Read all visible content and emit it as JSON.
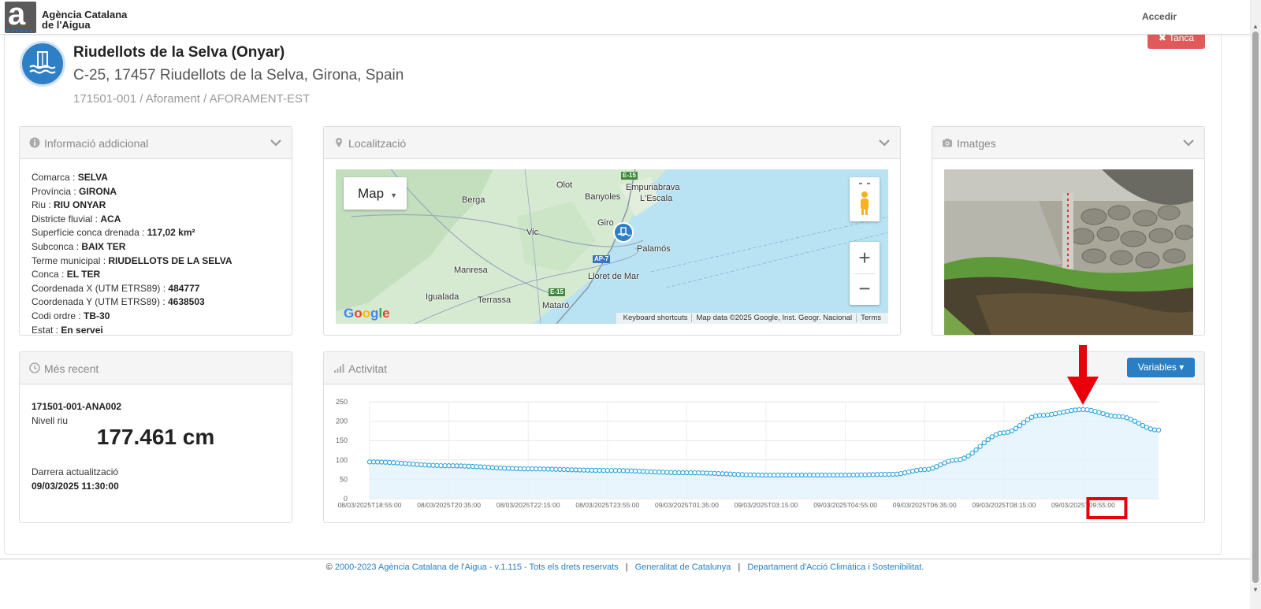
{
  "header": {
    "logo_text_line1": "Agència Catalana",
    "logo_text_line2": "de l'Aigua",
    "login_label": "Accedir",
    "logo_icon": "aca-logo-icon"
  },
  "station": {
    "close_label": "✖ Tanca",
    "title": "Riudellots de la Selva (Onyar)",
    "address": "C-25, 17457 Riudellots de la Selva, Girona, Spain",
    "code": "171501-001 / Aforament / AFORAMENT-EST",
    "icon": "gauging-station-icon"
  },
  "info_panel": {
    "title": "Informació addicional",
    "items": [
      {
        "label": "Comarca",
        "value": "SELVA"
      },
      {
        "label": "Província",
        "value": "GIRONA"
      },
      {
        "label": "Riu",
        "value": "RIU ONYAR"
      },
      {
        "label": "Districte fluvial",
        "value": "ACA"
      },
      {
        "label": "Superfície conca drenada",
        "value": "117,02 km²"
      },
      {
        "label": "Subconca",
        "value": "BAIX TER"
      },
      {
        "label": "Terme municipal",
        "value": "RIUDELLOTS DE LA SELVA"
      },
      {
        "label": "Conca",
        "value": "EL TER"
      },
      {
        "label": "Coordenada X (UTM ETRS89)",
        "value": "484777"
      },
      {
        "label": "Coordenada Y (UTM ETRS89)",
        "value": "4638503"
      },
      {
        "label": "Codi ordre",
        "value": "TB-30"
      },
      {
        "label": "Estat",
        "value": "En servei"
      }
    ]
  },
  "map_panel": {
    "title": "Localització",
    "map_type_label": "Map",
    "zoom_in": "+",
    "zoom_out": "−",
    "attribution": [
      "Keyboard shortcuts",
      "Map data ©2025 Google, Inst. Geogr. Nacional",
      "Terms"
    ],
    "google_label": "Google",
    "places": [
      "Olot",
      "Empuriabrava",
      "Berga",
      "Banyoles",
      "L'Escala",
      "Vic",
      "Giro",
      "Palamós",
      "Manresa",
      "Lloret de Mar",
      "Igualada",
      "Terrassa",
      "Mataró"
    ],
    "road_labels": [
      "E-15",
      "AP-7",
      "E-15"
    ]
  },
  "images_panel": {
    "title": "Imatges"
  },
  "recent_panel": {
    "title": "Més recent",
    "sensor_code": "171501-001-ANA002",
    "variable": "Nivell riu",
    "value": "177.461 cm",
    "updated_label": "Darrera actualització",
    "updated_value": "09/03/2025 11:30:00"
  },
  "activity_panel": {
    "title": "Activitat",
    "variables_label": "Variables ▾"
  },
  "chart_data": {
    "type": "line",
    "title": "",
    "xlabel": "",
    "ylabel": "",
    "ylim": [
      0,
      250
    ],
    "yticks": [
      0,
      50,
      100,
      150,
      200,
      250
    ],
    "xtick_labels": [
      "08/03/2025T18:55:00",
      "08/03/2025T20:35:00",
      "08/03/2025T22:15:00",
      "08/03/2025T23:55:00",
      "09/03/2025T01:35:00",
      "09/03/2025T03:15:00",
      "09/03/2025T04:55:00",
      "09/03/2025T06:35:00",
      "09/03/2025T08:15:00",
      "09/03/2025T09:55:00"
    ],
    "x_start": "08/03/2025T18:55:00",
    "x_end": "09/03/2025T11:30:00",
    "series": [
      {
        "color": "#2aa3de",
        "anchors": [
          {
            "t": "08/03/2025T18:55:00",
            "v": 95
          },
          {
            "t": "08/03/2025T20:35:00",
            "v": 85
          },
          {
            "t": "08/03/2025T22:15:00",
            "v": 77
          },
          {
            "t": "08/03/2025T23:55:00",
            "v": 73
          },
          {
            "t": "09/03/2025T01:35:00",
            "v": 67
          },
          {
            "t": "09/03/2025T03:15:00",
            "v": 61
          },
          {
            "t": "09/03/2025T04:55:00",
            "v": 61
          },
          {
            "t": "09/03/2025T05:55:00",
            "v": 63
          },
          {
            "t": "09/03/2025T06:35:00",
            "v": 75
          },
          {
            "t": "09/03/2025T07:15:00",
            "v": 100
          },
          {
            "t": "09/03/2025T08:15:00",
            "v": 170
          },
          {
            "t": "09/03/2025T09:00:00",
            "v": 215
          },
          {
            "t": "09/03/2025T09:55:00",
            "v": 230
          },
          {
            "t": "09/03/2025T10:40:00",
            "v": 212
          },
          {
            "t": "09/03/2025T11:30:00",
            "v": 177
          }
        ]
      }
    ],
    "grid": true,
    "legend": "none"
  },
  "annotations": {
    "arrow_color": "#e8000b",
    "highlight_color": "#e8000b"
  },
  "footer": {
    "copyright_symbol": "©",
    "copyright": "2000-2023 Agència Catalana de l'Aigua - v.1.115 - Tots els drets reservats",
    "link1": "Generalitat de Catalunya",
    "link2": "Departament d'Acció Climàtica i Sostenibilitat.",
    "separator": "|"
  }
}
